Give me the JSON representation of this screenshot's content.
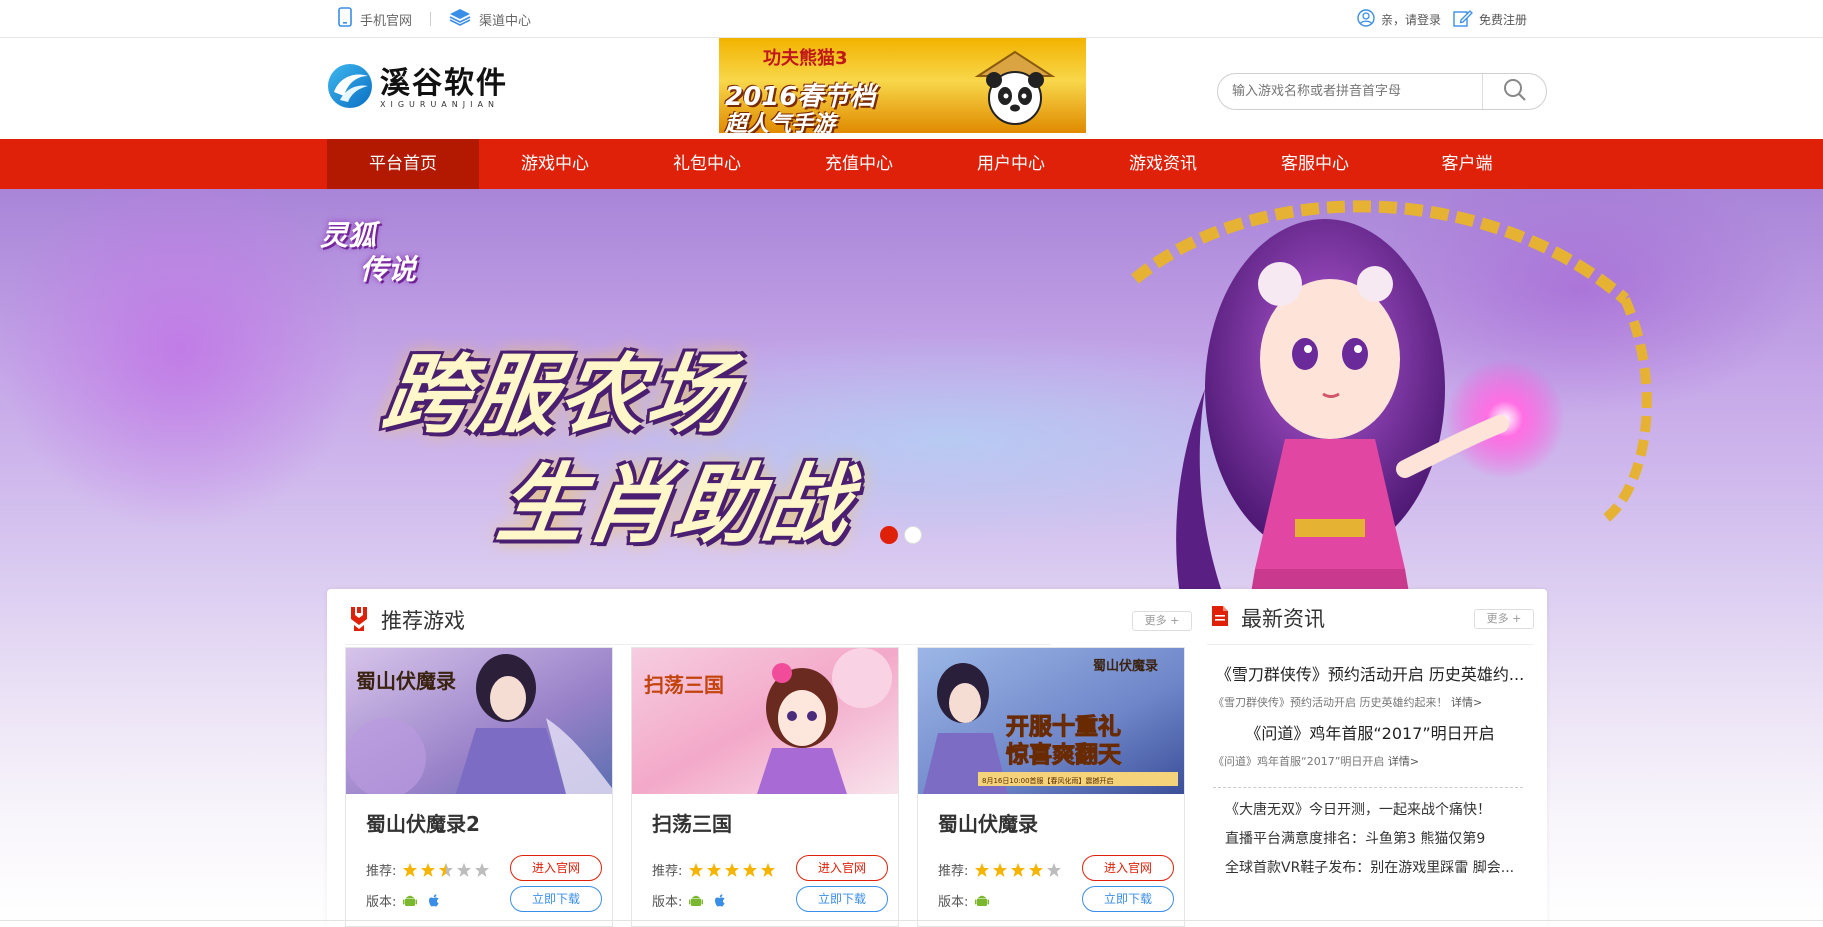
{
  "topbar": {
    "mobile_label": "手机官网",
    "channel_label": "渠道中心",
    "login_label": "亲，请登录",
    "register_label": "免费注册"
  },
  "header": {
    "logo_cn": "溪谷软件",
    "logo_en": "XIGURUANJIAN",
    "ad": {
      "line1": "功夫熊猫3",
      "line2": "2016春节档",
      "line3": "超人气手游"
    },
    "search": {
      "placeholder": "输入游戏名称或者拼音首字母"
    }
  },
  "nav": {
    "items": [
      "平台首页",
      "游戏中心",
      "礼包中心",
      "充值中心",
      "用户中心",
      "游戏资讯",
      "客服中心",
      "客户端"
    ],
    "active_index": 0
  },
  "banner": {
    "logo_line1": "灵狐",
    "logo_line2": "传说",
    "headline1": "跨服农场",
    "headline2": "生肖助战",
    "slide_count": 2,
    "active_slide": 0
  },
  "recommend": {
    "title": "推荐游戏",
    "more_label": "更多 +",
    "recommend_label": "推荐:",
    "version_label": "版本:",
    "btn_site": "进入官网",
    "btn_download": "立即下载",
    "games": [
      {
        "name": "蜀山伏魔录2",
        "stars": 2.5,
        "platforms": [
          "android-icon",
          "apple-icon"
        ],
        "thumb_title": "蜀山伏魔录"
      },
      {
        "name": "扫荡三国",
        "stars": 5,
        "platforms": [
          "android-icon",
          "apple-icon"
        ],
        "thumb_title": "扫荡三国"
      },
      {
        "name": "蜀山伏魔录",
        "stars": 4,
        "platforms": [
          "android-icon"
        ],
        "thumb_title": "蜀山伏魔录",
        "thumb_promo1": "开服十重礼",
        "thumb_promo2": "惊喜爽翻天",
        "thumb_promo3": "8月16日10:00首服【春风化雨】震撼开启"
      }
    ]
  },
  "news": {
    "title": "最新资讯",
    "more_label": "更多 +",
    "headlines": [
      {
        "title": "《雪刀群侠传》预约活动开启 历史英雄约...",
        "summary": "《雪刀群侠传》预约活动开启 历史英雄约起来！",
        "link": "详情>"
      },
      {
        "title": "《问道》鸡年首服“2017”明日开启",
        "summary": "《问道》鸡年首服“2017”明日开启",
        "link": "详情>"
      }
    ],
    "list": [
      "《大唐无双》今日开测，一起来战个痛快！",
      "直播平台满意度排名：斗鱼第3 熊猫仅第9",
      "全球首款VR鞋子发布：别在游戏里踩雷 脚会..."
    ]
  },
  "colors": {
    "brand_red": "#e0210a",
    "nav_active": "#b31800",
    "star": "#f5b400",
    "android": "#7cb82f",
    "apple": "#3b8ee8"
  }
}
